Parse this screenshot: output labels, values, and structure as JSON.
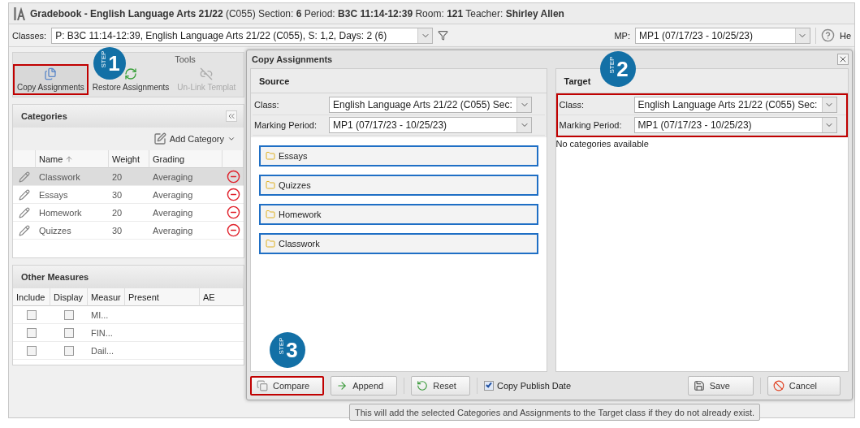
{
  "title": "**Gradebook - English Language Arts 21/22** (C055) Section: **6** Period: **B3C 11:14-12:39** Room: **121** Teacher: **Shirley Allen**",
  "classes_bar": {
    "label": "Classes:",
    "value": "P: B3C 11:14-12:39, English Language Arts 21/22 (C055), S: 1,2, Days: 2 (6)",
    "mp_label": "MP:",
    "mp_value": "MP1 (07/17/23 - 10/25/23)",
    "help": "He"
  },
  "tools": {
    "title": "Tools",
    "buttons": [
      {
        "kind": "copy",
        "label": "Copy Assignments",
        "disabled": false,
        "highlighted": true
      },
      {
        "kind": "restore",
        "label": "Restore Assignments",
        "disabled": false,
        "highlighted": false
      },
      {
        "kind": "unlink",
        "label": "Un-Link Templat",
        "disabled": true,
        "highlighted": false
      }
    ]
  },
  "categories": {
    "title": "Categories",
    "add_label": "Add Category",
    "columns": [
      "Name",
      "Weight",
      "Grading"
    ],
    "rows": [
      {
        "name": "Classwork",
        "weight": "20",
        "grading": "Averaging",
        "selected": true
      },
      {
        "name": "Essays",
        "weight": "30",
        "grading": "Averaging",
        "selected": false
      },
      {
        "name": "Homework",
        "weight": "20",
        "grading": "Averaging",
        "selected": false
      },
      {
        "name": "Quizzes",
        "weight": "30",
        "grading": "Averaging",
        "selected": false
      }
    ]
  },
  "other_measures": {
    "title": "Other Measures",
    "columns": [
      "Include",
      "Display",
      "Measur",
      "Present",
      "AE"
    ],
    "rows": [
      {
        "include": false,
        "display": false,
        "measure": "MI..."
      },
      {
        "include": false,
        "display": false,
        "measure": "FIN..."
      },
      {
        "include": false,
        "display": false,
        "measure": "Dail..."
      }
    ]
  },
  "dialog": {
    "title": "Copy Assignments",
    "source": {
      "title": "Source",
      "class_label": "Class:",
      "class_value": "English Language Arts 21/22 (C055) Sec:",
      "mp_label": "Marking Period:",
      "mp_value": "MP1 (07/17/23 - 10/25/23)",
      "categories": [
        "Essays",
        "Quizzes",
        "Homework",
        "Classwork"
      ]
    },
    "target": {
      "title": "Target",
      "highlighted": true,
      "class_label": "Class:",
      "class_value": "English Language Arts 21/22 (C055) Sec:",
      "mp_label": "Marking Period:",
      "mp_value": "MP1 (07/17/23 - 10/25/23)",
      "empty_text": "No categories available"
    },
    "left_buttons": [
      {
        "kind": "compare",
        "label": "Compare",
        "highlighted": true
      },
      {
        "kind": "append",
        "label": "Append",
        "highlighted": false
      },
      {
        "kind": "reset",
        "label": "Reset",
        "highlighted": false
      }
    ],
    "copy_publish_date": {
      "label": "Copy Publish Date",
      "checked": true
    },
    "right_buttons": [
      {
        "kind": "save",
        "label": "Save"
      },
      {
        "kind": "cancel",
        "label": "Cancel"
      }
    ]
  },
  "tooltip": "This will add the selected Categories and Assignments to the Target class if they do not already exist.",
  "steps": [
    {
      "word": "STEP",
      "number": "1"
    },
    {
      "word": "STEP",
      "number": "2"
    },
    {
      "word": "STEP",
      "number": "3"
    }
  ]
}
